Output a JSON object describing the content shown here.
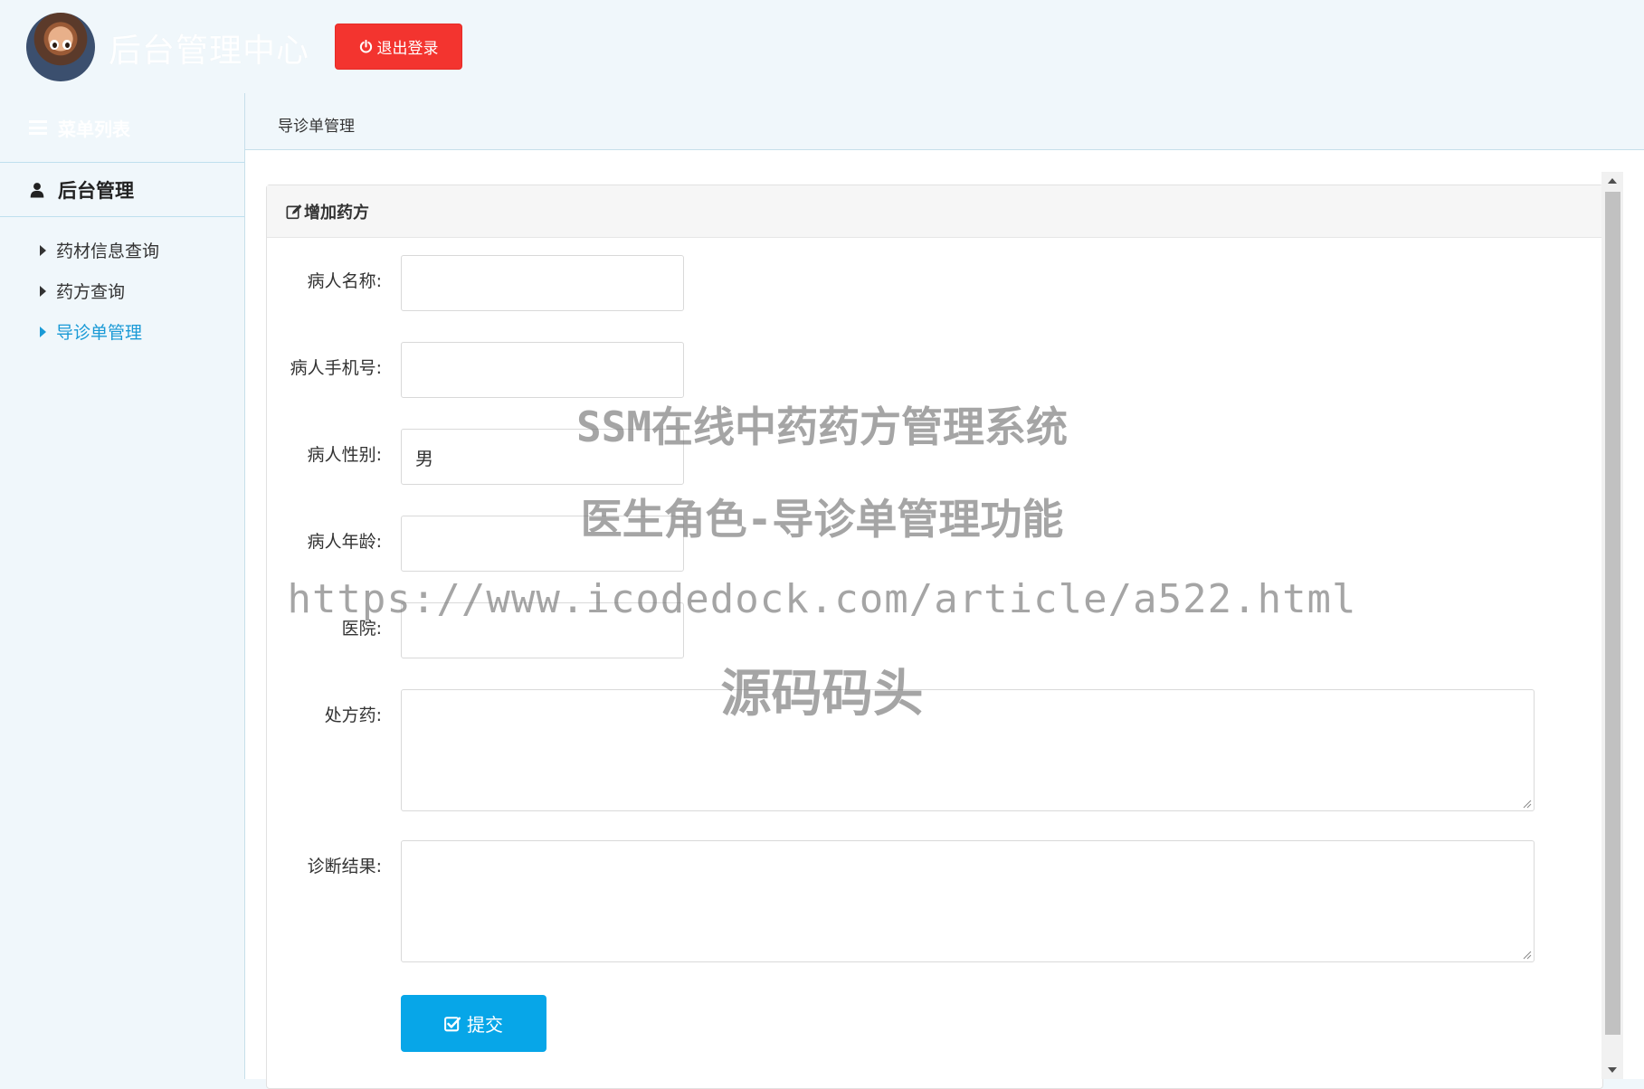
{
  "header": {
    "app_title": "后台管理中心",
    "logout_label": "退出登录",
    "logout_color": "#f3342f",
    "avatar_icon": "avatar"
  },
  "sidebar": {
    "menu_title": "菜单列表",
    "group_label": "后台管理",
    "group_icon": "user-icon",
    "items": [
      {
        "label": "药材信息查询",
        "active": false
      },
      {
        "label": "药方查询",
        "active": false
      },
      {
        "label": "导诊单管理",
        "active": true
      }
    ],
    "active_color": "#1a9ad6"
  },
  "breadcrumb": "导诊单管理",
  "form": {
    "title": "增加药方",
    "title_icon": "edit-icon",
    "fields": [
      {
        "label": "病人名称:",
        "value": ""
      },
      {
        "label": "病人手机号:",
        "value": ""
      },
      {
        "label": "病人性别:",
        "value": "男"
      },
      {
        "label": "病人年龄:",
        "value": ""
      },
      {
        "label": "医院:",
        "value": ""
      }
    ],
    "textareas": [
      {
        "label": "处方药:",
        "value": ""
      },
      {
        "label": "诊断结果:",
        "value": ""
      }
    ],
    "submit_label": "提交",
    "submit_icon": "check-square-icon",
    "submit_color": "#07a6e8"
  },
  "watermark": {
    "line1": "SSM在线中药药方管理系统",
    "line2": "医生角色-导诊单管理功能",
    "line3": "https://www.icodedock.com/article/a522.html",
    "line4": "源码码头"
  }
}
